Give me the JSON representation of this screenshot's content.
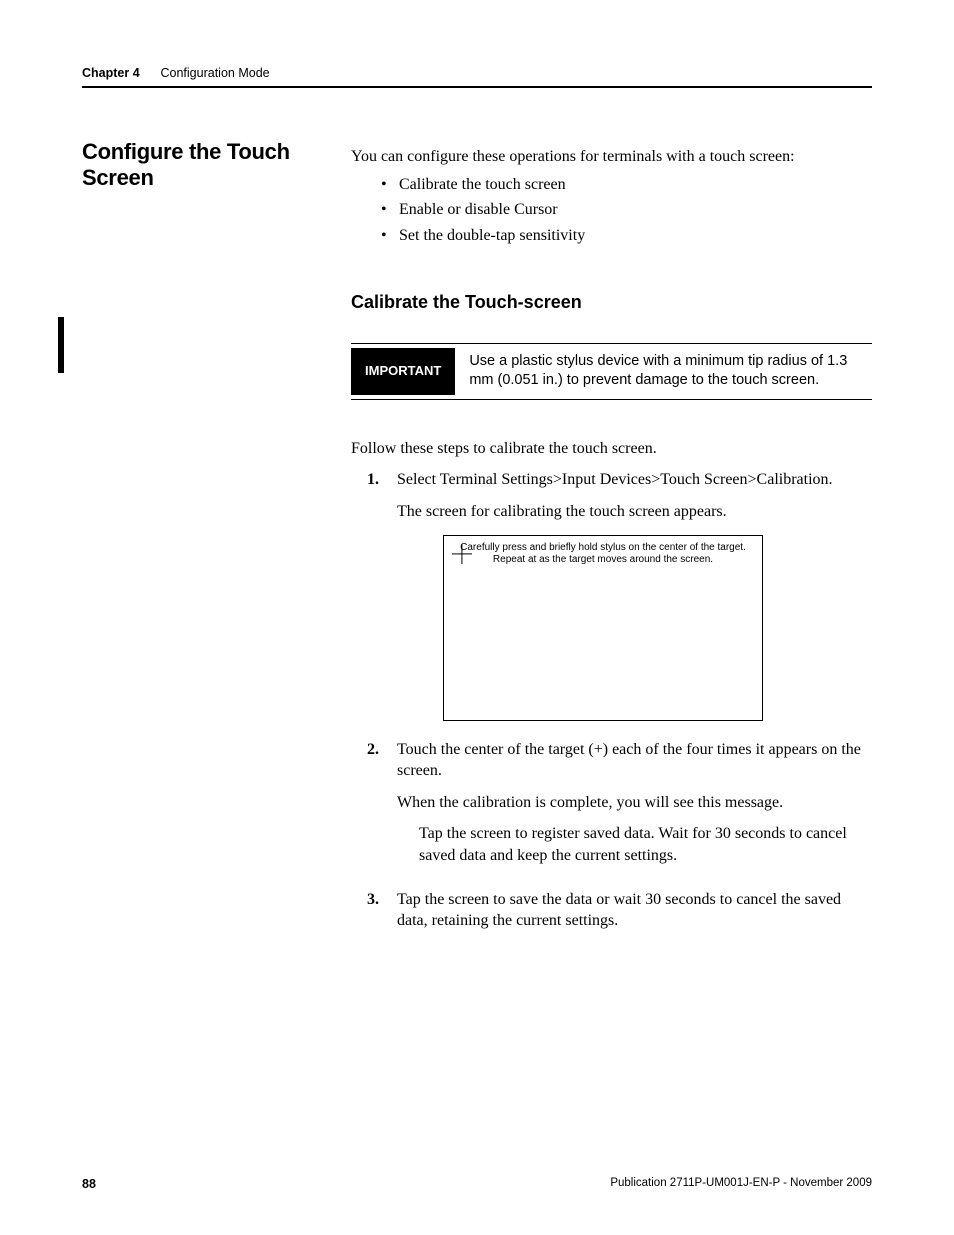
{
  "header": {
    "chapter": "Chapter 4",
    "title": "Configuration Mode"
  },
  "sideHeading": "Configure the Touch Screen",
  "intro": "You can configure these operations for terminals with a touch screen:",
  "bullets": [
    "Calibrate the touch screen",
    "Enable or disable Cursor",
    "Set the double-tap sensitivity"
  ],
  "subHeading": "Calibrate the Touch-screen",
  "important": {
    "label": "IMPORTANT",
    "text": "Use a plastic stylus device with a minimum tip radius of 1.3 mm (0.051 in.) to prevent damage to the touch screen."
  },
  "follow": "Follow these steps to calibrate the touch screen.",
  "steps": {
    "s1": {
      "main": "Select Terminal Settings>Input Devices>Touch Screen>Calibration.",
      "p1": "The screen for calibrating the touch screen appears."
    },
    "calib": {
      "line1": "Carefully press and briefly hold stylus on the center of the target.",
      "line2": "Repeat at as the target moves around the screen."
    },
    "s2": {
      "main": "Touch the center of the target (+) each of the four times it appears on the screen.",
      "p1": "When the calibration is complete, you will see this message.",
      "ind": "Tap the screen to register saved data. Wait for 30 seconds to cancel saved data and keep the current settings."
    },
    "s3": {
      "main": "Tap the screen to save the data or wait 30 seconds to cancel the saved data, retaining the current settings."
    }
  },
  "footer": {
    "pageNum": "88",
    "pub": "Publication 2711P-UM001J-EN-P - November 2009"
  }
}
